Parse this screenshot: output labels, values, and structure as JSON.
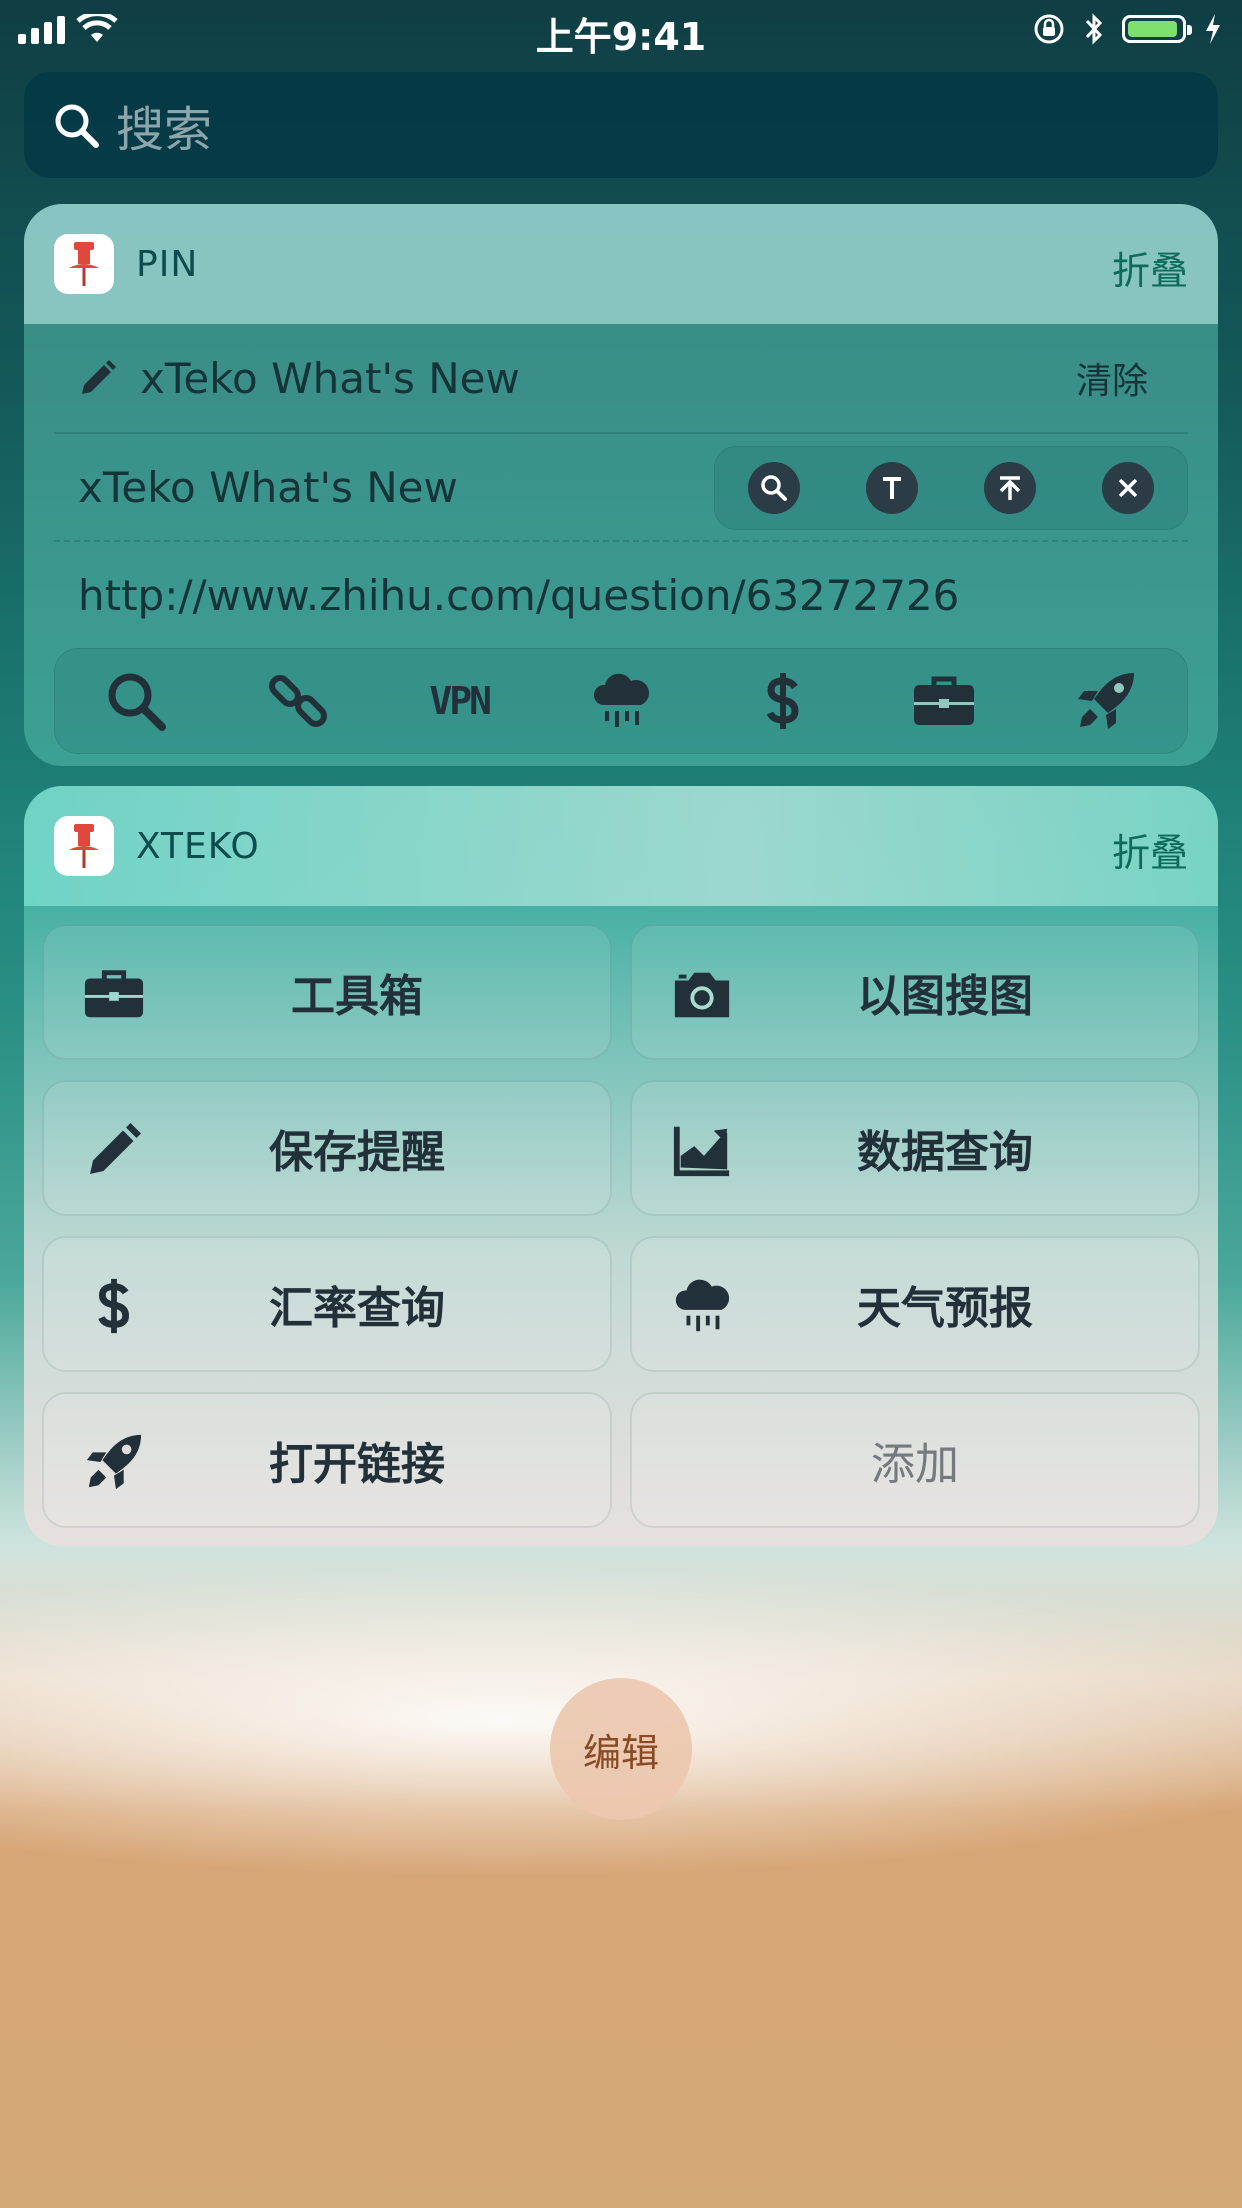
{
  "status_bar": {
    "time": "上午9:41",
    "battery_level": 0.95
  },
  "search": {
    "placeholder": "搜索",
    "icon": "search-icon"
  },
  "pin_widget": {
    "title": "PIN",
    "collapse_label": "折叠",
    "edit_row": {
      "text": "xTeko What's New",
      "clear_label": "清除",
      "icon": "pencil-icon"
    },
    "clip_row": {
      "text": "xTeko What's New",
      "actions": [
        "search-icon",
        "text-icon",
        "upload-icon",
        "close-icon"
      ]
    },
    "url": "http://www.zhihu.com/question/63272726",
    "toolbar": [
      {
        "icon": "search-icon"
      },
      {
        "icon": "link-icon"
      },
      {
        "icon": "vpn-icon",
        "label": "VPN"
      },
      {
        "icon": "rain-cloud-icon"
      },
      {
        "icon": "dollar-icon"
      },
      {
        "icon": "toolbox-icon"
      },
      {
        "icon": "rocket-icon"
      }
    ]
  },
  "xteko_widget": {
    "title": "XTEKO",
    "collapse_label": "折叠",
    "tiles": [
      {
        "label": "工具箱",
        "icon": "toolbox-icon"
      },
      {
        "label": "以图搜图",
        "icon": "camera-icon"
      },
      {
        "label": "保存提醒",
        "icon": "pencil-icon"
      },
      {
        "label": "数据查询",
        "icon": "chart-icon"
      },
      {
        "label": "汇率查询",
        "icon": "dollar-icon"
      },
      {
        "label": "天气预报",
        "icon": "rain-cloud-icon"
      },
      {
        "label": "打开链接",
        "icon": "rocket-icon"
      },
      {
        "label": "添加",
        "icon": ""
      }
    ]
  },
  "edit_button": {
    "label": "编辑"
  },
  "colors": {
    "icon_dark": "#2b3c46",
    "pin_red": "#e0483c",
    "accent_green": "#0d6a5c"
  }
}
